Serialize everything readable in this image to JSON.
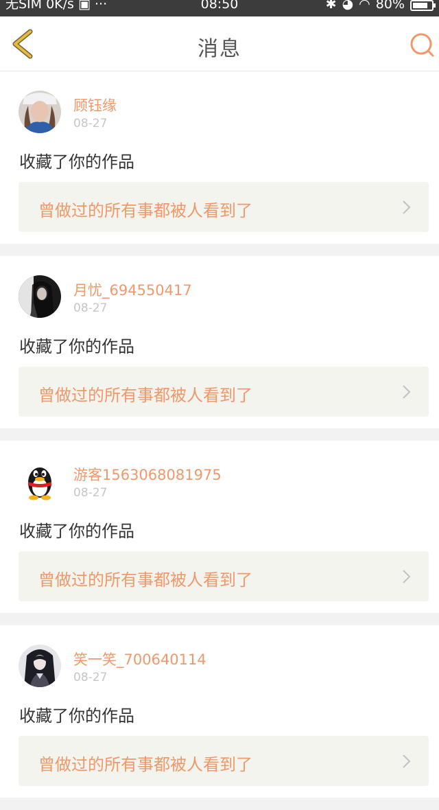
{
  "status_bar": {
    "carrier": "无SIM 0K/s",
    "time": "08:50",
    "battery": "80%",
    "battery_level": 0.8
  },
  "header": {
    "title": "消息"
  },
  "messages": [
    {
      "user": "顾钰缘",
      "date": "08-27",
      "action": "收藏了你的作品",
      "work_title": "曾做过的所有事都被人看到了"
    },
    {
      "user": "月忧_694550417",
      "date": "08-27",
      "action": "收藏了你的作品",
      "work_title": "曾做过的所有事都被人看到了"
    },
    {
      "user": "游客1563068081975",
      "date": "08-27",
      "action": "收藏了你的作品",
      "work_title": "曾做过的所有事都被人看到了"
    },
    {
      "user": "笑一笑_700640114",
      "date": "08-27",
      "action": "收藏了你的作品",
      "work_title": "曾做过的所有事都被人看到了"
    }
  ],
  "colors": {
    "accent": "#f0986a",
    "back_icon": "#e9b83e",
    "card_bg": "#ffffff",
    "page_bg": "#f2f2f2",
    "link_bg": "#f4f4ef"
  }
}
